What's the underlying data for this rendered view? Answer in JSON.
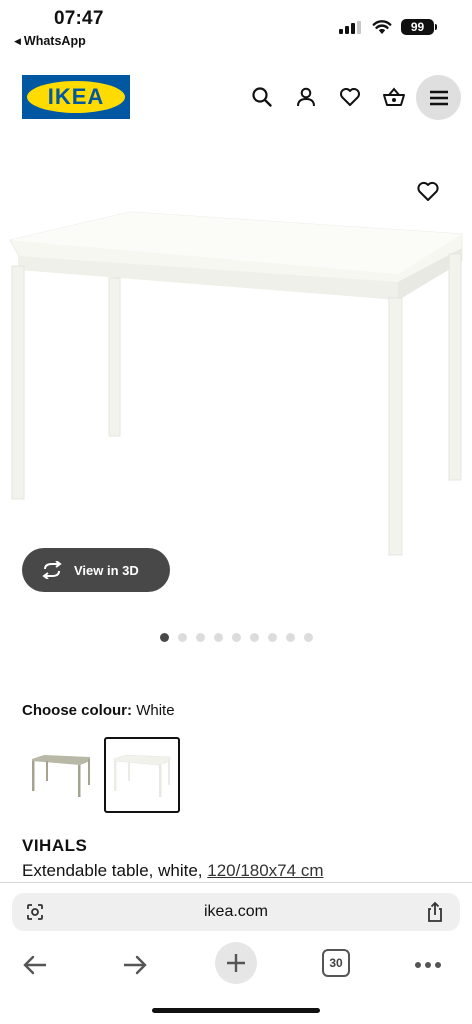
{
  "status_bar": {
    "time": "07:47",
    "back_app": "WhatsApp",
    "battery": "99"
  },
  "header": {
    "logo_text": "IKEA",
    "brand_colors": {
      "blue": "#0058a3",
      "yellow": "#ffdb00"
    },
    "icons": [
      "search-icon",
      "account-icon",
      "heart-icon",
      "basket-icon",
      "menu-icon"
    ]
  },
  "gallery": {
    "view3d_label": "View in 3D",
    "image_count": 9,
    "active_index": 0
  },
  "colour": {
    "label": "Choose colour:",
    "value": "White",
    "options": [
      "grey-green",
      "white"
    ],
    "selected": "white"
  },
  "product": {
    "name": "VIHALS",
    "description": "Extendable table, white, ",
    "size": "120/180x74 cm"
  },
  "browser": {
    "url": "ikea.com",
    "tab_count": "30"
  }
}
